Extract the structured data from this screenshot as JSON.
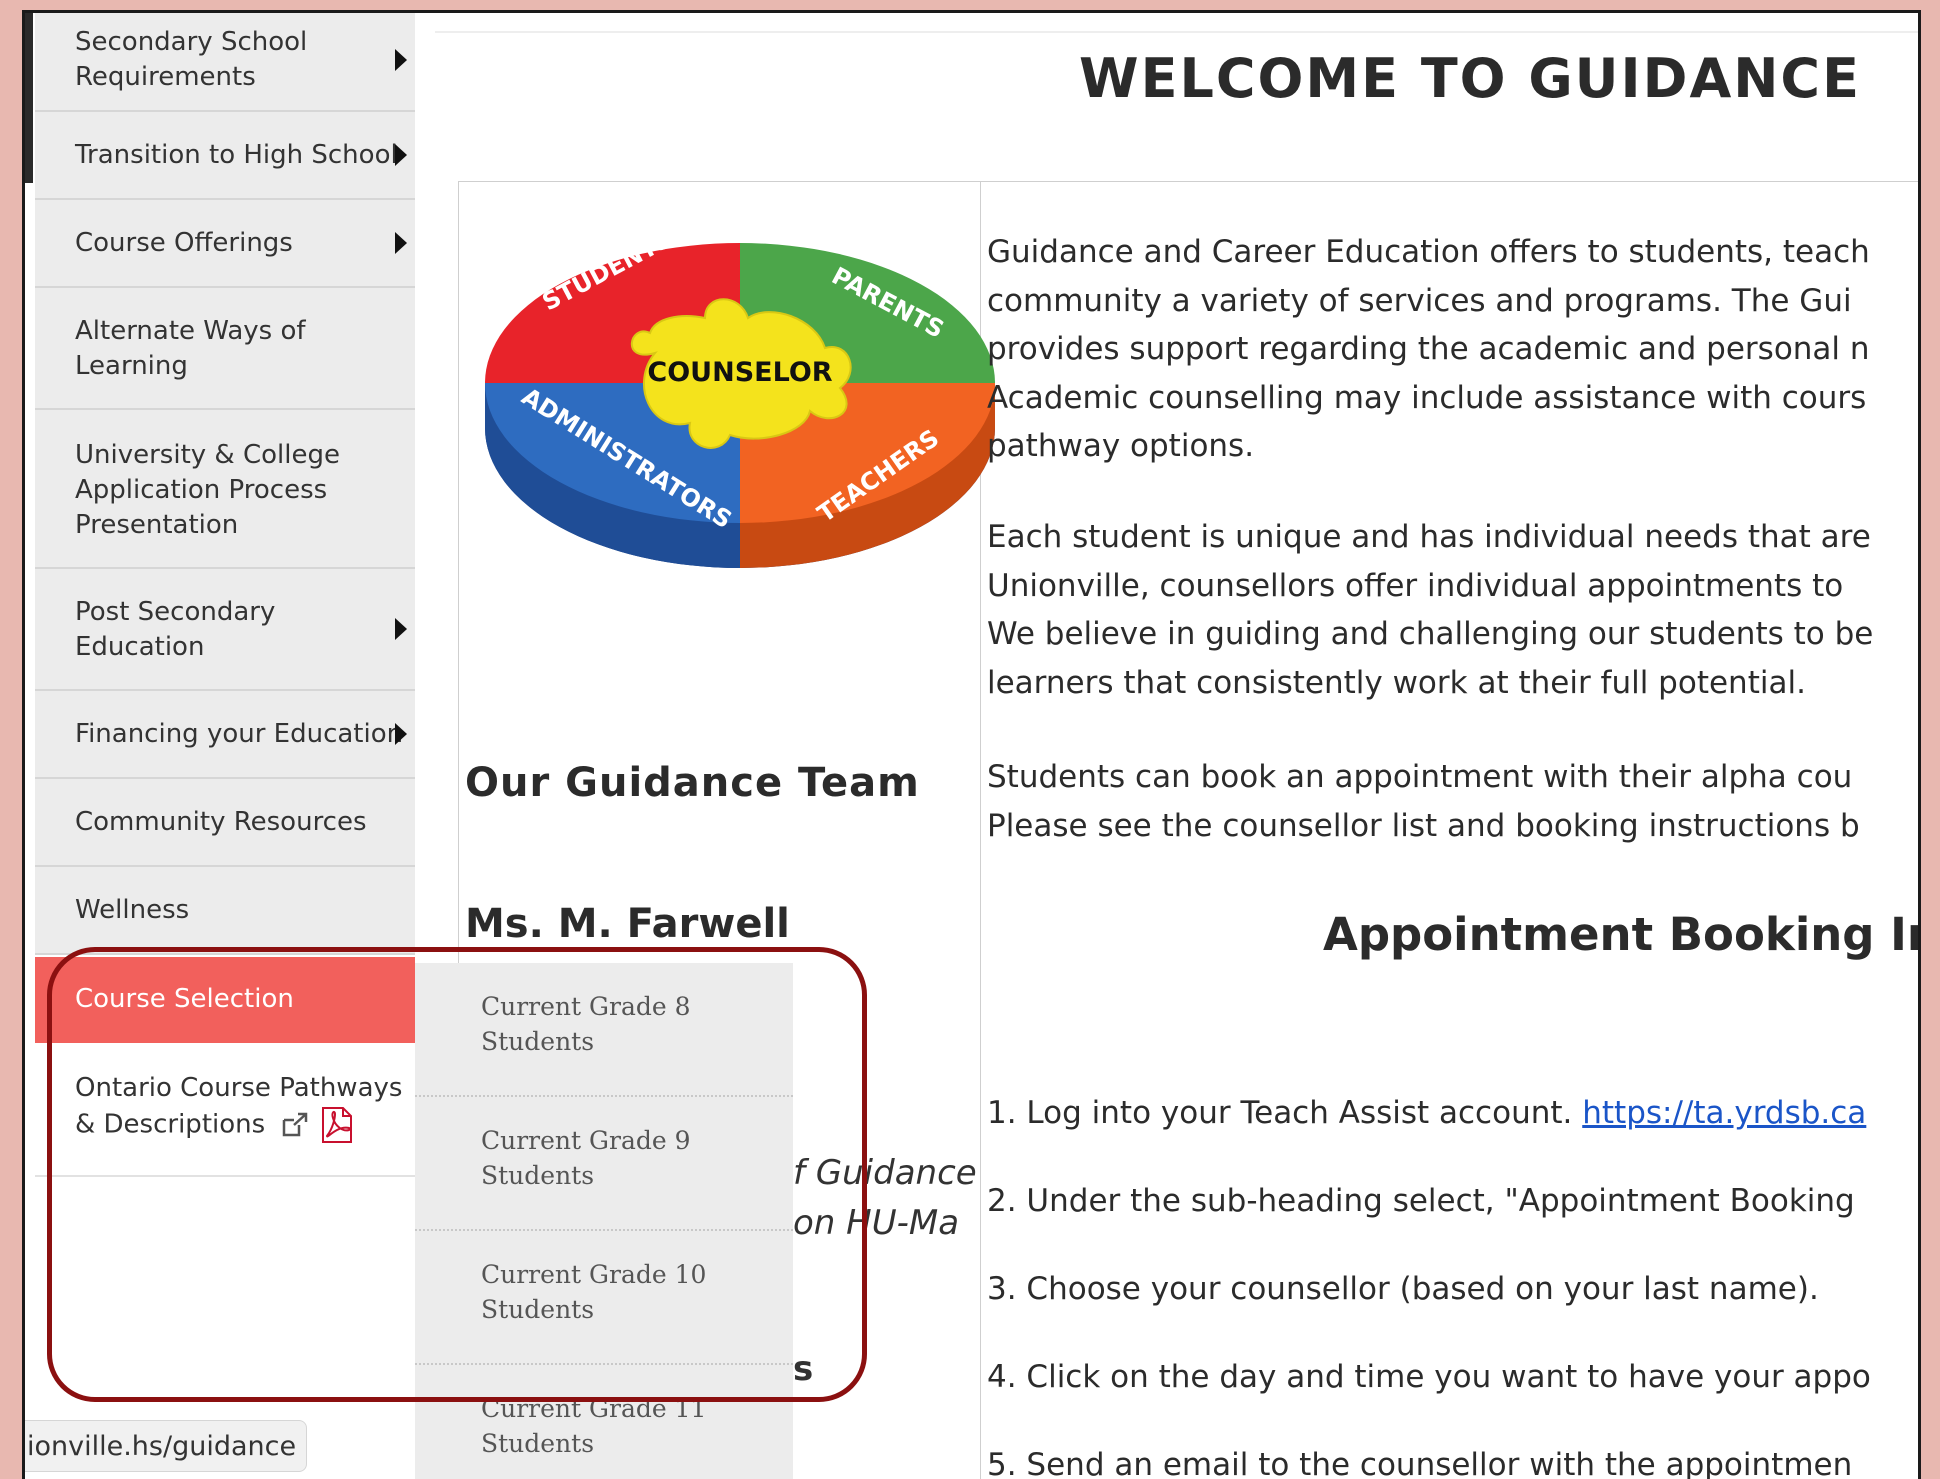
{
  "status_url": "ionville.hs/guidance",
  "sidebar": {
    "items": [
      {
        "label": "Secondary School Requirements",
        "line1": "Secondary School",
        "line2": "Requirements",
        "has_submenu": true
      },
      {
        "label": "Transition to High School",
        "has_submenu": true
      },
      {
        "label": "Course Offerings",
        "has_submenu": true
      },
      {
        "label": "Alternate Ways of Learning",
        "line1": "Alternate Ways of",
        "line2": "Learning",
        "has_submenu": false
      },
      {
        "label": "University & College Application Process Presentation",
        "line1": "University & College",
        "line2": "Application Process",
        "line3": "Presentation",
        "has_submenu": false
      },
      {
        "label": "Post Secondary Education",
        "line1": "Post Secondary",
        "line2": "Education",
        "has_submenu": true
      },
      {
        "label": "Financing your Education",
        "has_submenu": true
      },
      {
        "label": "Community Resources",
        "has_submenu": false
      },
      {
        "label": "Wellness",
        "has_submenu": false
      },
      {
        "label": "Course Selection",
        "has_submenu": true,
        "active": true
      },
      {
        "label": "Ontario Course Pathways & Descriptions",
        "line1": "Ontario Course Pathways",
        "line2": "& Descriptions",
        "has_submenu": false
      }
    ]
  },
  "submenu": {
    "items": [
      {
        "line1": "Current Grade 8",
        "line2": "Students"
      },
      {
        "line1": "Current Grade 9",
        "line2": "Students"
      },
      {
        "line1": "Current Grade 10",
        "line2": "Students"
      },
      {
        "line1": "Current Grade 11",
        "line2": "Students"
      }
    ]
  },
  "main": {
    "title": "WELCOME TO GUIDANCE",
    "logo": {
      "center": "COUNSELOR",
      "top_left": "STUDENTS",
      "top_right": "PARENTS",
      "bottom_left": "ADMINISTRATORS",
      "bottom_right": "TEACHERS",
      "colors": {
        "red": "#e8232a",
        "green": "#4ca64a",
        "blue": "#2e6cc0",
        "orange": "#f26322",
        "yellow": "#f4e31c"
      }
    },
    "team_heading": "Our Guidance Team",
    "person_name": "Ms. M. Farwell",
    "hidden_fragment_1": "f Guidance",
    "hidden_fragment_2": "on HU-Ma",
    "hidden_fragment_3": "s",
    "paragraph1": [
      "Guidance and Career Education offers to students, teach",
      "community a variety of services and programs.  The Gui",
      "provides support regarding the academic and personal n",
      "Academic counselling may include assistance with cours",
      "pathway options."
    ],
    "paragraph2": [
      "Each student is unique and has individual needs that are",
      "Unionville, counsellors offer individual appointments to",
      "We believe in guiding and challenging our students to be",
      "learners that consistently work at their full potential."
    ],
    "paragraph3": [
      "Students can book an appointment with their alpha cou",
      "Please see the counsellor list and booking instructions b"
    ],
    "instructions_heading": "Appointment Booking Inst",
    "steps": [
      {
        "text": "1. Log into your Teach Assist account. ",
        "link": "https://ta.yrdsb.ca"
      },
      {
        "text": "2. Under the sub-heading select, \"Appointment Booking"
      },
      {
        "text": "3. Choose your counsellor (based on your last name)."
      },
      {
        "text": "4. Click on the day and time you want to have your appo"
      },
      {
        "text": "5. Send an email to the counsellor with the appointmen"
      }
    ]
  },
  "colors": {
    "active_menu": "#f2605c",
    "highlight_border": "#8b1010",
    "link": "#1a55c8",
    "background": "#e8b8b0"
  }
}
